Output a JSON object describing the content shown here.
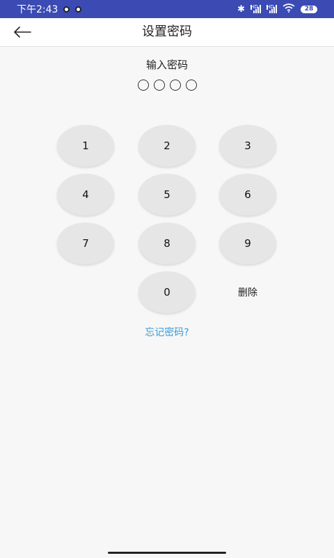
{
  "status_bar": {
    "time": "下午2:43",
    "battery": "28",
    "network_badge_1": "HD",
    "network_badge_2": "HD"
  },
  "header": {
    "title": "设置密码",
    "back_icon": "arrow-left-icon"
  },
  "pin": {
    "prompt": "输入密码",
    "length": 4,
    "filled": 0
  },
  "keypad": {
    "keys": [
      "1",
      "2",
      "3",
      "4",
      "5",
      "6",
      "7",
      "8",
      "9",
      "0"
    ],
    "delete_label": "删除"
  },
  "forgot_link": "忘记密码?",
  "colors": {
    "status_bar": "#3b4bb3",
    "key_bg": "#e6e6e6",
    "link": "#3a9bd5",
    "background": "#f7f7f7"
  }
}
